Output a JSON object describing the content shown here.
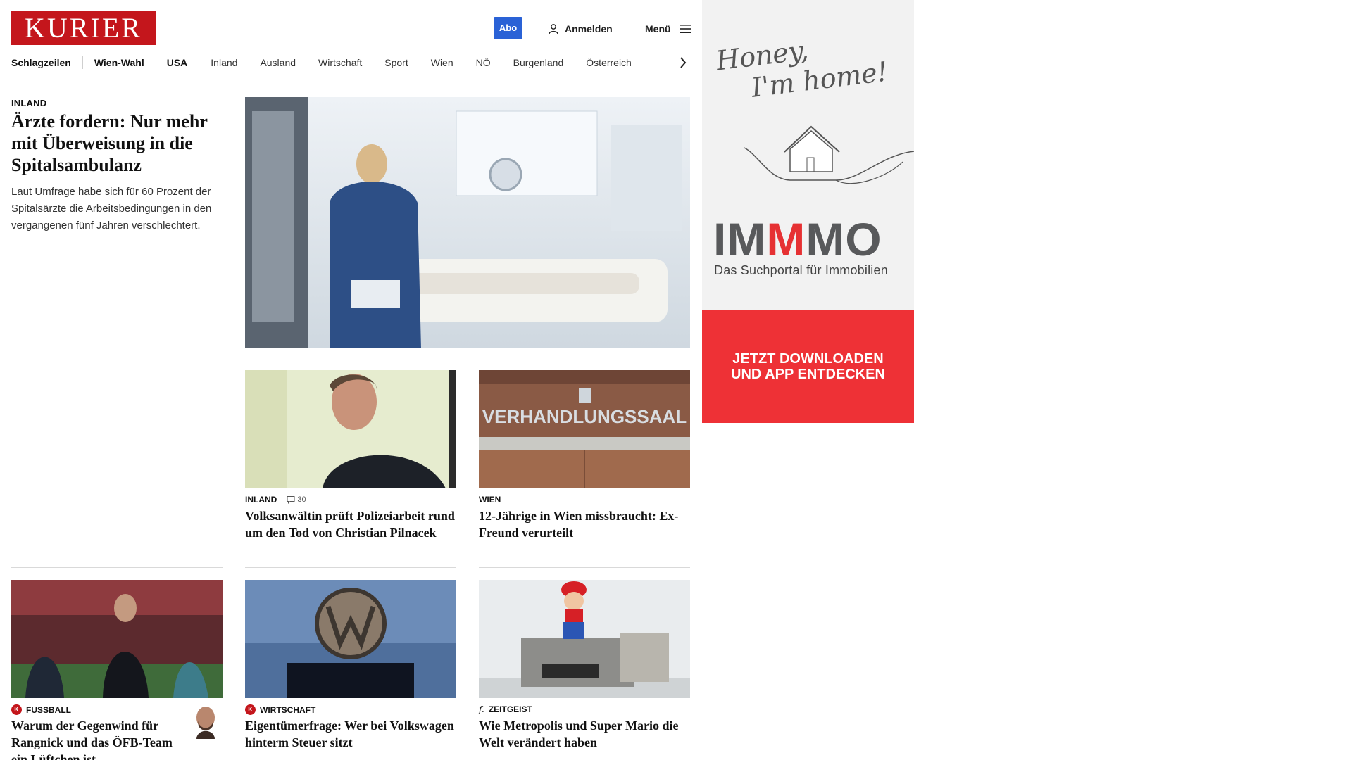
{
  "header": {
    "logo_text": "KURIER",
    "abo_label": "Abo",
    "login_label": "Anmelden",
    "menu_label": "Menü"
  },
  "nav": {
    "items": [
      "Schlagzeilen",
      "Wien-Wahl",
      "USA",
      "Inland",
      "Ausland",
      "Wirtschaft",
      "Sport",
      "Wien",
      "NÖ",
      "Burgenland",
      "Österreich"
    ]
  },
  "lead": {
    "kicker": "INLAND",
    "title": "Ärzte fordern: Nur mehr mit Überweisung in die Spitalsambulanz",
    "text": "Laut Umfrage habe sich für 60 Prozent der Spitalsärzte die Arbeitsbedingungen in den vergangenen fünf Jahren verschlechtert."
  },
  "cards": [
    {
      "kicker": "INLAND",
      "comments": "30",
      "title": "Volksanwältin prüft Polizeiarbeit rund um den Tod von Christian Pilnacek"
    },
    {
      "kicker": "WIEN",
      "title": "12-Jährige in Wien missbraucht: Ex-Freund verurteilt",
      "image_text": "VERHANDLUNGSSAAL"
    },
    {
      "kicker": "FUSSBALL",
      "badge": "K",
      "title": "Warum der Gegenwind für Rangnick und das ÖFB-Team ein Lüftchen ist"
    },
    {
      "kicker": "WIRTSCHAFT",
      "badge": "K",
      "title": "Eigentümerfrage: Wer bei Volkswagen hinterm Steuer sitzt"
    },
    {
      "kicker": "ZEITGEIST",
      "badge": "f.",
      "title": "Wie Metropolis und Super Mario die Welt verändert haben"
    }
  ],
  "ad": {
    "script_line1": "Honey,",
    "script_line2": "I'm home!",
    "brand_part1": "IM",
    "brand_part2": "M",
    "brand_part3": "MO",
    "tagline": "Das Suchportal für Immobilien",
    "cta": "JETZT DOWNLOADEN UND APP ENTDECKEN"
  },
  "colors": {
    "brand_red": "#c4161c",
    "abo_blue": "#2a62d6",
    "ad_red": "#ee3136"
  }
}
